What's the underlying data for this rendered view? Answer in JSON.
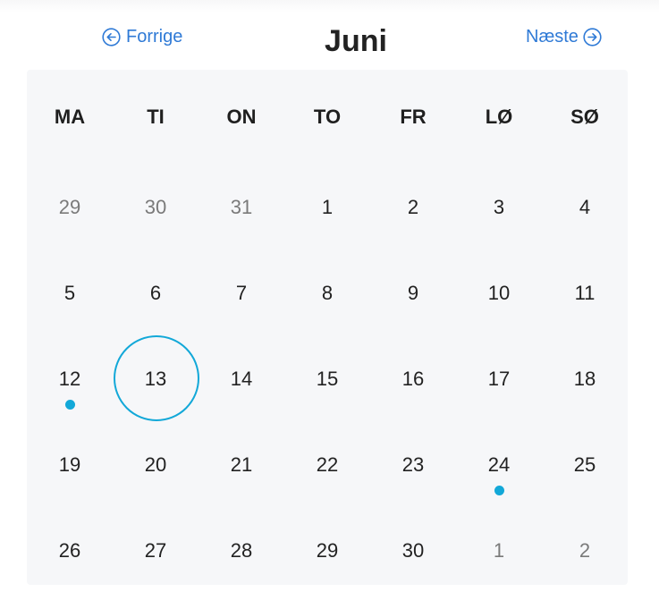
{
  "header": {
    "prev_label": "Forrige",
    "next_label": "Næste",
    "month_title": "Juni",
    "prev_icon": "arrow-left-circle-icon",
    "next_icon": "arrow-right-circle-icon"
  },
  "colors": {
    "link": "#2f7ad6",
    "accent": "#12a8d8",
    "calendar_bg": "#f6f7f9",
    "muted_text": "#7a7a7a"
  },
  "weekdays": [
    "MA",
    "TI",
    "ON",
    "TO",
    "FR",
    "LØ",
    "SØ"
  ],
  "weeks": [
    [
      {
        "label": "29",
        "muted": true
      },
      {
        "label": "30",
        "muted": true
      },
      {
        "label": "31",
        "muted": true
      },
      {
        "label": "1"
      },
      {
        "label": "2"
      },
      {
        "label": "3"
      },
      {
        "label": "4"
      }
    ],
    [
      {
        "label": "5"
      },
      {
        "label": "6"
      },
      {
        "label": "7"
      },
      {
        "label": "8"
      },
      {
        "label": "9"
      },
      {
        "label": "10"
      },
      {
        "label": "11"
      }
    ],
    [
      {
        "label": "12",
        "event": true
      },
      {
        "label": "13",
        "selected": true
      },
      {
        "label": "14"
      },
      {
        "label": "15"
      },
      {
        "label": "16"
      },
      {
        "label": "17"
      },
      {
        "label": "18"
      }
    ],
    [
      {
        "label": "19"
      },
      {
        "label": "20"
      },
      {
        "label": "21"
      },
      {
        "label": "22"
      },
      {
        "label": "23"
      },
      {
        "label": "24",
        "event": true
      },
      {
        "label": "25"
      }
    ],
    [
      {
        "label": "26"
      },
      {
        "label": "27"
      },
      {
        "label": "28"
      },
      {
        "label": "29"
      },
      {
        "label": "30"
      },
      {
        "label": "1",
        "muted": true
      },
      {
        "label": "2",
        "muted": true
      }
    ]
  ]
}
